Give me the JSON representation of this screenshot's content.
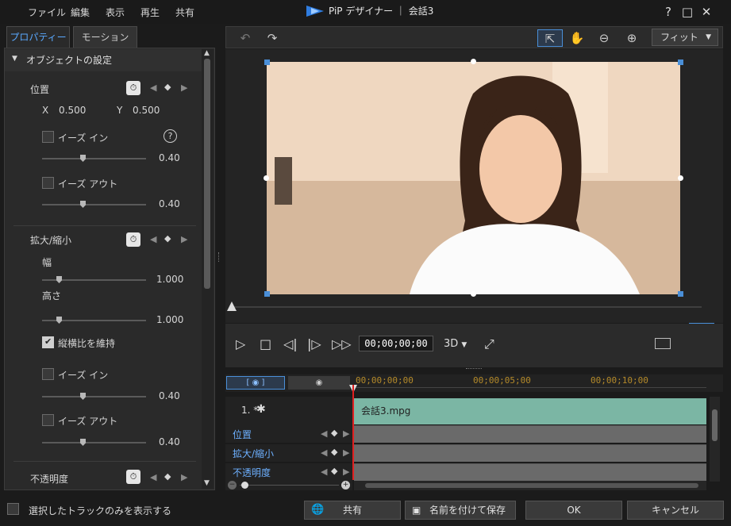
{
  "menu": [
    "ファイル",
    "編集",
    "表示",
    "再生",
    "共有"
  ],
  "title": "PiP デザイナー ｜ 会話3",
  "window_buttons": {
    "help": "?",
    "maximize": "□",
    "close": "✕"
  },
  "tabs": {
    "properties": "プロパティー",
    "motion": "モーション"
  },
  "object_settings": "オブジェクトの設定",
  "position": {
    "label": "位置",
    "x_label": "X",
    "x_value": "0.500",
    "y_label": "Y",
    "y_value": "0.500",
    "ease_in": "イーズ イン",
    "ease_in_value": "0.40",
    "ease_out": "イーズ アウト",
    "ease_out_value": "0.40"
  },
  "scale": {
    "label": "拡大/縮小",
    "width_label": "幅",
    "width_value": "1.000",
    "height_label": "高さ",
    "height_value": "1.000",
    "keep_aspect": "縦横比を維持",
    "ease_in": "イーズ イン",
    "ease_in_value": "0.40",
    "ease_out": "イーズ アウト",
    "ease_out_value": "0.40"
  },
  "opacity": {
    "label": "不透明度"
  },
  "toolbar": {
    "fit": "フィット"
  },
  "transport": {
    "timecode": "00;00;00;00",
    "mode3d": "3D"
  },
  "timeline": {
    "ruler": [
      "00;00;00;00",
      "00;00;05;00",
      "00;00;10;00"
    ],
    "track_name": "1. *",
    "clip_name": "会話3.mpg",
    "rows": [
      "位置",
      "拡大/縮小",
      "不透明度"
    ]
  },
  "bottom": {
    "only_selected": "選択したトラックのみを表示する",
    "share": "共有",
    "save_as": "名前を付けて保存",
    "ok": "OK",
    "cancel": "キャンセル"
  },
  "colors": {
    "accent": "#5aa9ff",
    "clip": "#7bb6a4",
    "playhead": "#e02020"
  }
}
